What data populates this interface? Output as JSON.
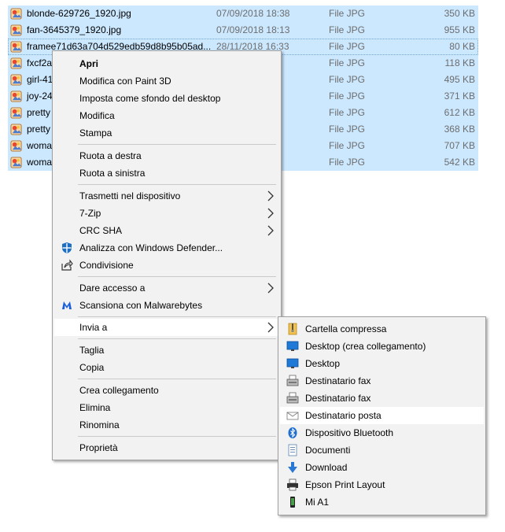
{
  "files": [
    {
      "name": "blonde-629726_1920.jpg",
      "date": "07/09/2018 18:38",
      "type": "File JPG",
      "size": "350 KB"
    },
    {
      "name": "fan-3645379_1920.jpg",
      "date": "07/09/2018 18:13",
      "type": "File JPG",
      "size": "955 KB"
    },
    {
      "name": "framee71d63a704d529edb59d8b95b05ad...",
      "date": "28/11/2018 16:33",
      "type": "File JPG",
      "size": "80 KB"
    },
    {
      "name": "fxcf2a",
      "date": "",
      "type": "File JPG",
      "size": "118 KB"
    },
    {
      "name": "girl-41",
      "date": "",
      "type": "File JPG",
      "size": "495 KB"
    },
    {
      "name": "joy-24",
      "date": "",
      "type": "File JPG",
      "size": "371 KB"
    },
    {
      "name": "pretty",
      "date": "",
      "type": "File JPG",
      "size": "612 KB"
    },
    {
      "name": "pretty",
      "date": "",
      "type": "File JPG",
      "size": "368 KB"
    },
    {
      "name": "woma",
      "date": "",
      "type": "File JPG",
      "size": "707 KB"
    },
    {
      "name": "woma",
      "date": "",
      "type": "File JPG",
      "size": "542 KB"
    }
  ],
  "context_menu": {
    "items": [
      {
        "label": "Apri"
      },
      {
        "label": "Modifica con Paint 3D"
      },
      {
        "label": "Imposta come sfondo del desktop"
      },
      {
        "label": "Modifica"
      },
      {
        "label": "Stampa"
      },
      {
        "label": "Ruota a destra"
      },
      {
        "label": "Ruota a sinistra"
      },
      {
        "label": "Trasmetti nel dispositivo"
      },
      {
        "label": "7-Zip"
      },
      {
        "label": "CRC SHA"
      },
      {
        "label": "Analizza con Windows Defender...",
        "icon": "windows-defender-icon"
      },
      {
        "label": "Condivisione",
        "icon": "share-icon"
      },
      {
        "label": "Dare accesso a"
      },
      {
        "label": "Scansiona con Malwarebytes",
        "icon": "malwarebytes-icon"
      },
      {
        "label": "Invia a"
      },
      {
        "label": "Taglia"
      },
      {
        "label": "Copia"
      },
      {
        "label": "Crea collegamento"
      },
      {
        "label": "Elimina"
      },
      {
        "label": "Rinomina"
      },
      {
        "label": "Proprietà"
      }
    ]
  },
  "submenu": {
    "items": [
      {
        "label": "Cartella compressa",
        "icon": "zip-folder-icon"
      },
      {
        "label": "Desktop (crea collegamento)",
        "icon": "desktop-icon"
      },
      {
        "label": "Desktop",
        "icon": "desktop-icon"
      },
      {
        "label": "Destinatario fax",
        "icon": "fax-icon"
      },
      {
        "label": "Destinatario fax",
        "icon": "fax-icon"
      },
      {
        "label": "Destinatario posta",
        "icon": "mail-icon"
      },
      {
        "label": "Dispositivo Bluetooth",
        "icon": "bluetooth-icon"
      },
      {
        "label": "Documenti",
        "icon": "documents-icon"
      },
      {
        "label": "Download",
        "icon": "download-icon"
      },
      {
        "label": "Epson Print Layout",
        "icon": "printer-icon"
      },
      {
        "label": "Mi A1",
        "icon": "phone-icon"
      }
    ]
  },
  "colors": {
    "selection": "#cce8ff",
    "menu_bg": "#f2f2f2",
    "hover": "#ffffff"
  }
}
